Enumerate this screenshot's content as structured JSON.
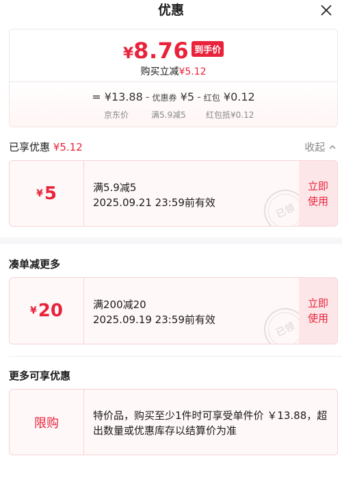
{
  "header": {
    "title": "优惠"
  },
  "price": {
    "currency": "¥",
    "value": "8.76",
    "badge": "到手价",
    "reduce_label": "购买立减",
    "reduce_value": "¥5.12"
  },
  "formula": {
    "eq": "=",
    "jd_price": "¥13.88",
    "minus1": "-",
    "coupon_label": "优惠券",
    "coupon_value": "¥5",
    "minus2": "-",
    "redpacket_label": "红包",
    "redpacket_value": "¥0.12"
  },
  "labels": {
    "jd": "京东价",
    "full": "满5.9减5",
    "redpacket": "红包抵¥0.12"
  },
  "enjoyed": {
    "label": "已享优惠",
    "value": "¥5.12",
    "collapse": "收起"
  },
  "coupons": [
    {
      "currency": "¥",
      "amount": "5",
      "condition": "满5.9减5",
      "expiry": "2025.09.21 23:59前有效",
      "action": "立即使用",
      "stamp": "已领"
    },
    {
      "currency": "¥",
      "amount": "20",
      "condition": "满200减20",
      "expiry": "2025.09.19 23:59前有效",
      "action": "立即使用",
      "stamp": "已领"
    }
  ],
  "sections": {
    "more_combine": "凑单减更多",
    "more_offers": "更多可享优惠"
  },
  "limit": {
    "tag": "限购",
    "text": "特价品，购买至少1件时可享受单件价 ￥13.88，超出数量或优惠库存以结算价为准"
  },
  "colors": {
    "accent": "#e8233b",
    "card_bg": "#fff8f8",
    "use_bg": "#fde6e8"
  }
}
